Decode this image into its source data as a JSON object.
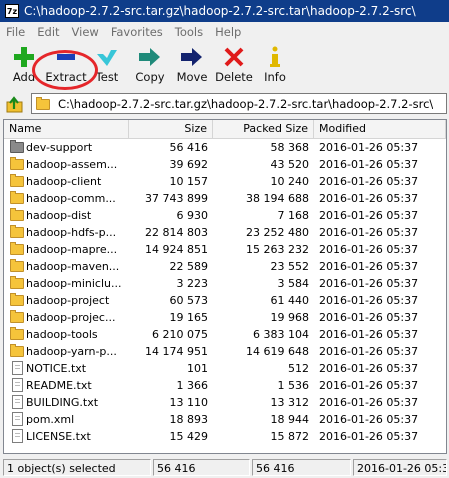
{
  "window": {
    "title": "C:\\hadoop-2.7.2-src.tar.gz\\hadoop-2.7.2-src.tar\\hadoop-2.7.2-src\\",
    "app_icon": "7z"
  },
  "menu": [
    "File",
    "Edit",
    "View",
    "Favorites",
    "Tools",
    "Help"
  ],
  "toolbar": {
    "add": "Add",
    "extract": "Extract",
    "test": "Test",
    "copy": "Copy",
    "move": "Move",
    "delete": "Delete",
    "info": "Info"
  },
  "address": {
    "path": "C:\\hadoop-2.7.2-src.tar.gz\\hadoop-2.7.2-src.tar\\hadoop-2.7.2-src\\"
  },
  "columns": {
    "name": "Name",
    "size": "Size",
    "packed": "Packed Size",
    "modified": "Modified"
  },
  "files": [
    {
      "name": "dev-support",
      "size": "56 416",
      "packed": "58 368",
      "modified": "2016-01-26 05:37",
      "type": "folder-dark"
    },
    {
      "name": "hadoop-assem...",
      "size": "39 692",
      "packed": "43 520",
      "modified": "2016-01-26 05:37",
      "type": "folder"
    },
    {
      "name": "hadoop-client",
      "size": "10 157",
      "packed": "10 240",
      "modified": "2016-01-26 05:37",
      "type": "folder"
    },
    {
      "name": "hadoop-comm...",
      "size": "37 743 899",
      "packed": "38 194 688",
      "modified": "2016-01-26 05:37",
      "type": "folder"
    },
    {
      "name": "hadoop-dist",
      "size": "6 930",
      "packed": "7 168",
      "modified": "2016-01-26 05:37",
      "type": "folder"
    },
    {
      "name": "hadoop-hdfs-p...",
      "size": "22 814 803",
      "packed": "23 252 480",
      "modified": "2016-01-26 05:37",
      "type": "folder"
    },
    {
      "name": "hadoop-mapre...",
      "size": "14 924 851",
      "packed": "15 263 232",
      "modified": "2016-01-26 05:37",
      "type": "folder"
    },
    {
      "name": "hadoop-maven...",
      "size": "22 589",
      "packed": "23 552",
      "modified": "2016-01-26 05:37",
      "type": "folder"
    },
    {
      "name": "hadoop-miniclu...",
      "size": "3 223",
      "packed": "3 584",
      "modified": "2016-01-26 05:37",
      "type": "folder"
    },
    {
      "name": "hadoop-project",
      "size": "60 573",
      "packed": "61 440",
      "modified": "2016-01-26 05:37",
      "type": "folder"
    },
    {
      "name": "hadoop-projec...",
      "size": "19 165",
      "packed": "19 968",
      "modified": "2016-01-26 05:37",
      "type": "folder"
    },
    {
      "name": "hadoop-tools",
      "size": "6 210 075",
      "packed": "6 383 104",
      "modified": "2016-01-26 05:37",
      "type": "folder"
    },
    {
      "name": "hadoop-yarn-p...",
      "size": "14 174 951",
      "packed": "14 619 648",
      "modified": "2016-01-26 05:37",
      "type": "folder"
    },
    {
      "name": "NOTICE.txt",
      "size": "101",
      "packed": "512",
      "modified": "2016-01-26 05:37",
      "type": "file"
    },
    {
      "name": "README.txt",
      "size": "1 366",
      "packed": "1 536",
      "modified": "2016-01-26 05:37",
      "type": "file"
    },
    {
      "name": "BUILDING.txt",
      "size": "13 110",
      "packed": "13 312",
      "modified": "2016-01-26 05:37",
      "type": "file"
    },
    {
      "name": "pom.xml",
      "size": "18 893",
      "packed": "18 944",
      "modified": "2016-01-26 05:37",
      "type": "file"
    },
    {
      "name": "LICENSE.txt",
      "size": "15 429",
      "packed": "15 872",
      "modified": "2016-01-26 05:37",
      "type": "file"
    }
  ],
  "status": {
    "selected": "1 object(s) selected",
    "size": "56 416",
    "packed": "56 416",
    "modified": "2016-01-26 05:37"
  },
  "colors": {
    "title_bar": "#0f3d8a",
    "highlight_circle": "#e5262a",
    "folder": "#f5c43b"
  }
}
